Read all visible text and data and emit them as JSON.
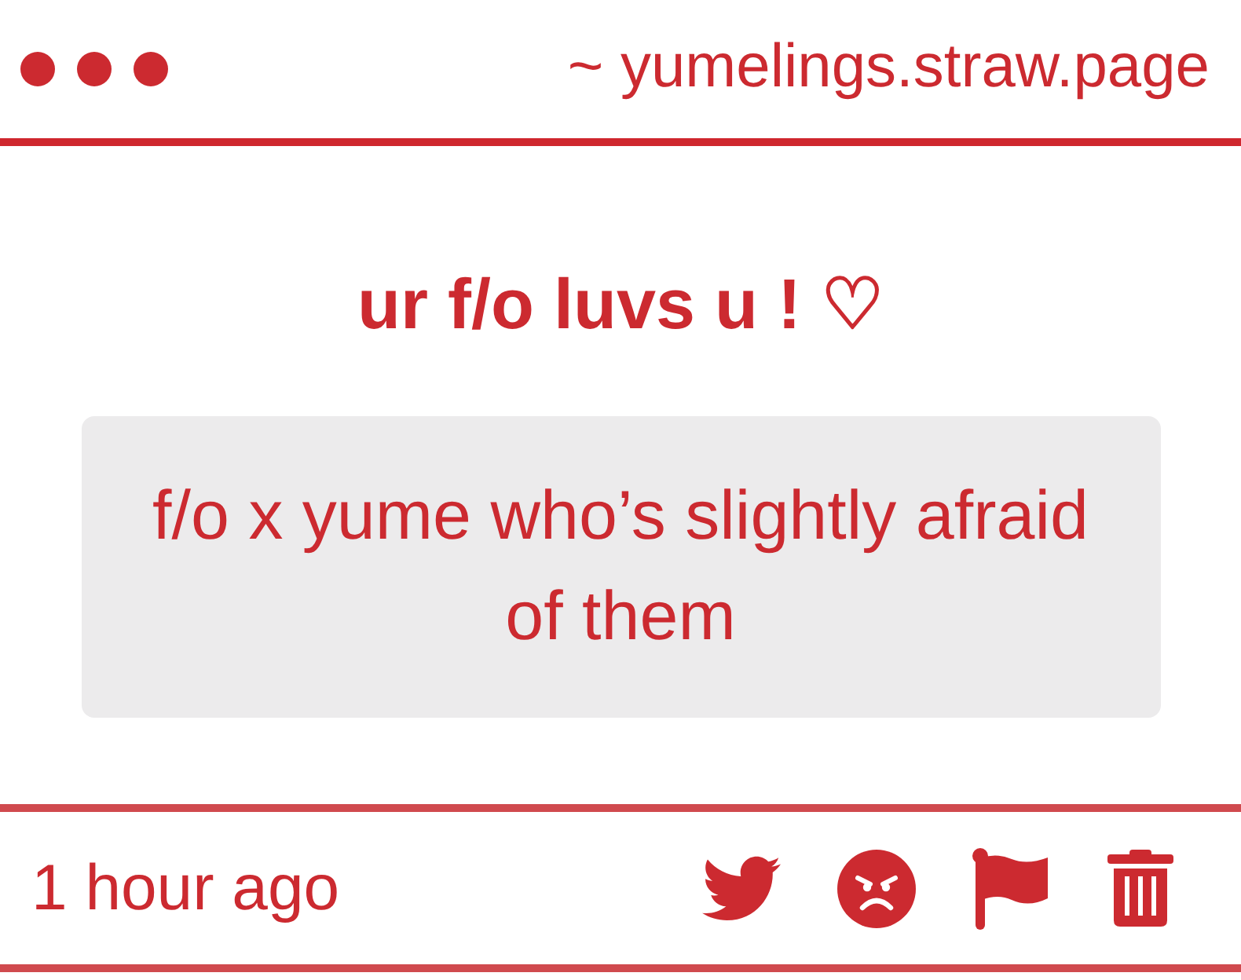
{
  "header": {
    "site": "~ yumelings.straw.page"
  },
  "message": {
    "title": "ur f/o luvs u ! ♡",
    "body": "f/o x yume who’s slightly afraid of them"
  },
  "footer": {
    "time": "1 hour ago",
    "actions": [
      {
        "kind": "twitter"
      },
      {
        "kind": "angry"
      },
      {
        "kind": "flag"
      },
      {
        "kind": "delete"
      }
    ]
  }
}
